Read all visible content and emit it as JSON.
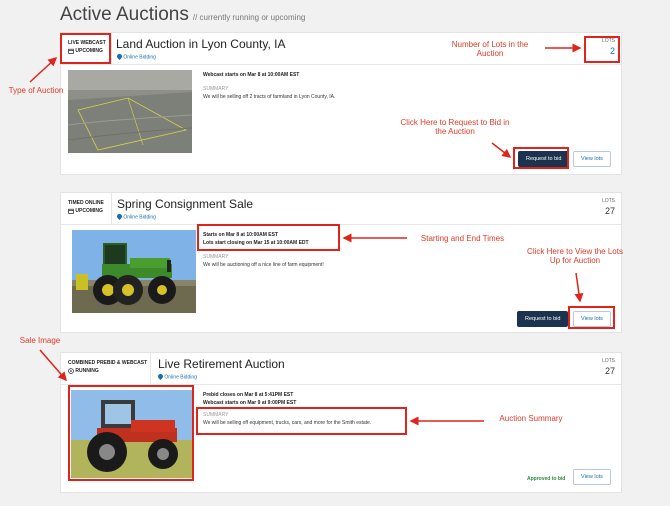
{
  "page": {
    "title": "Active Auctions",
    "subtitle": "// currently running or upcoming"
  },
  "auctions": [
    {
      "type": "LIVE WEBCAST",
      "status": "UPCOMING",
      "title": "Land Auction in Lyon County, IA",
      "bidding": "Online Bidding",
      "lots_label": "LOTS",
      "lots": "2",
      "times": [
        "Webcast starts on Mar 8 at 10:00AM EST"
      ],
      "summary_label": "SUMMARY",
      "summary": "We will be selling off 2 tracts of farmland in Lyon County, IA.",
      "primary_button": "Request to bid",
      "secondary_button": "View lots"
    },
    {
      "type": "TIMED ONLINE",
      "status": "UPCOMING",
      "title": "Spring Consignment Sale",
      "bidding": "Online Bidding",
      "lots_label": "LOTS",
      "lots": "27",
      "times": [
        "Starts on Mar 8 at 10:00AM EST",
        "Lots start closing on Mar 15 at 10:00AM EDT"
      ],
      "summary_label": "SUMMARY",
      "summary": "We will be auctioning off a nice line of farm equipment!",
      "primary_button": "Request to bid",
      "secondary_button": "View lots"
    },
    {
      "type": "COMBINED PREBID & WEBCAST",
      "status": "RUNNING",
      "title": "Live Retirement Auction",
      "bidding": "Online Bidding",
      "lots_label": "LOTS",
      "lots": "27",
      "times": [
        "Prebid closes on Mar 8 at 5:41PM EST",
        "Webcast starts on Mar 9 at 9:00PM EST"
      ],
      "summary_label": "SUMMARY",
      "summary": "We will be selling off equipment, trucks, cars, and more for the Smith estate.",
      "approved": "Approved to bid",
      "secondary_button": "View lots"
    }
  ],
  "annotations": {
    "type_of_auction": "Type of Auction",
    "number_of_lots": "Number of Lots in the Auction",
    "request_to_bid": "Click Here to Request to Bid in the Auction",
    "start_end_times": "Starting and End Times",
    "view_lots": "Click Here to View the Lots Up for Auction",
    "sale_image": "Sale Image",
    "auction_summary": "Auction Summary"
  },
  "colors": {
    "annotation_red": "#e0241b",
    "button_dark": "#1c3350",
    "link_blue": "#1a6fb3",
    "approved_green": "#2a8a3a"
  }
}
